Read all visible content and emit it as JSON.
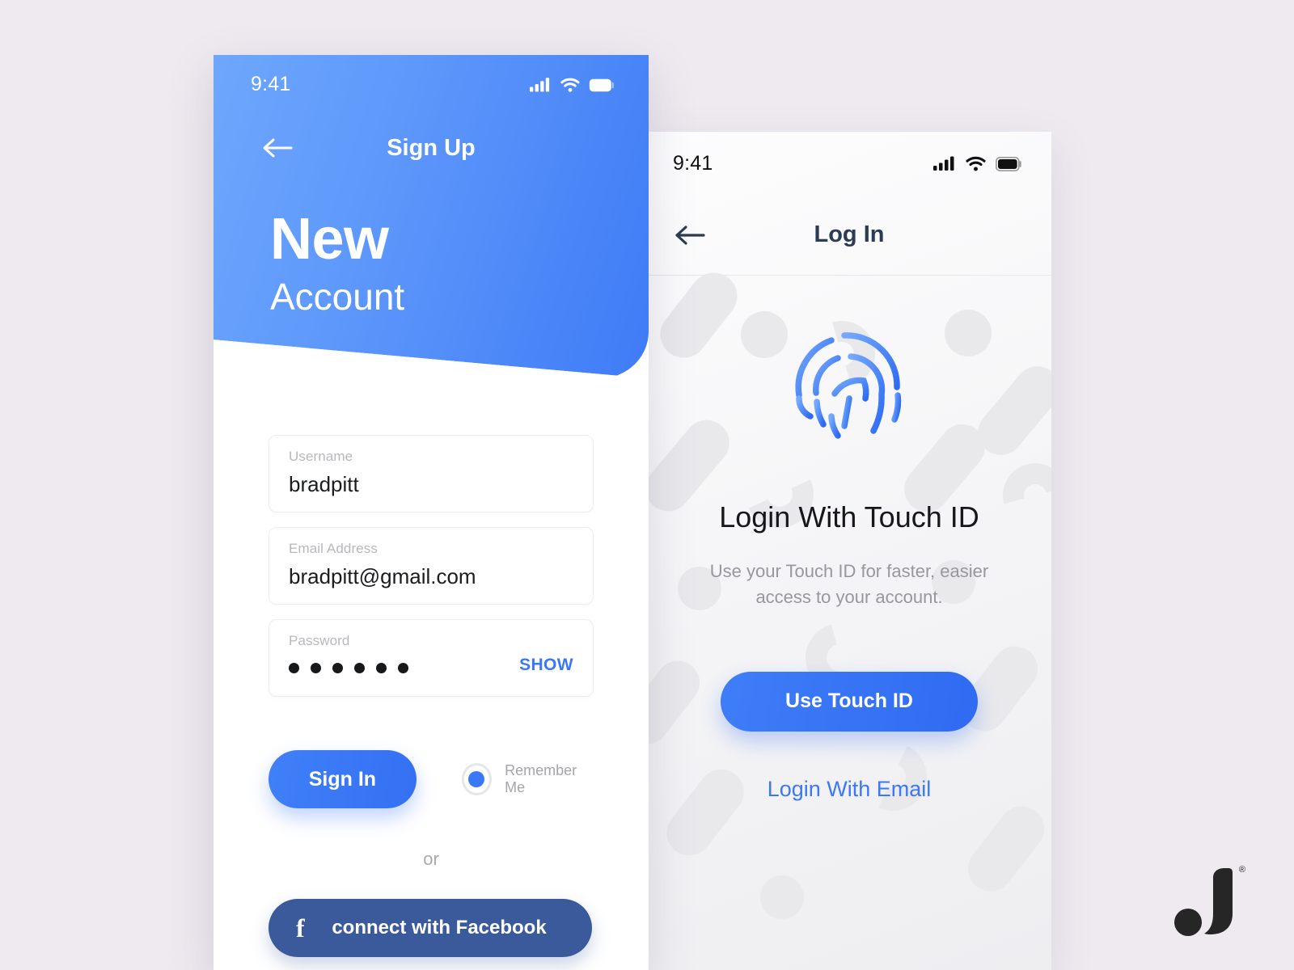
{
  "page": {
    "background_color": "#eeeaf0",
    "accent_blue": "#3b78f7",
    "facebook_blue": "#3b5a9b"
  },
  "signup_screen": {
    "status_bar": {
      "time": "9:41",
      "signal_icon": "cellular-signal-icon",
      "wifi_icon": "wifi-icon",
      "battery_icon": "battery-icon"
    },
    "nav": {
      "back_icon": "back-arrow-icon",
      "title": "Sign Up"
    },
    "hero": {
      "line1": "New",
      "line2": "Account"
    },
    "fields": [
      {
        "label": "Username",
        "value": "bradpitt"
      },
      {
        "label": "Email Address",
        "value": "bradpitt@gmail.com"
      }
    ],
    "password_field": {
      "label": "Password",
      "masked_dots": 6,
      "show_label": "SHOW"
    },
    "signin_button": "Sign In",
    "remember_me": {
      "label": "Remember Me",
      "checked": true
    },
    "divider_text": "or",
    "facebook_button": {
      "icon": "facebook-f-icon",
      "label": "connect with Facebook"
    }
  },
  "login_screen": {
    "status_bar": {
      "time": "9:41",
      "signal_icon": "cellular-signal-icon",
      "wifi_icon": "wifi-icon",
      "battery_icon": "battery-icon"
    },
    "nav": {
      "back_icon": "back-arrow-icon",
      "title": "Log In"
    },
    "fingerprint_icon": "fingerprint-icon",
    "heading": "Login With Touch ID",
    "description": "Use your Touch ID for faster, easier access to your account.",
    "primary_button": "Use Touch ID",
    "secondary_link": "Login With Email"
  },
  "branding": {
    "logo_icon": "j-letter-logo",
    "registered_mark": "®"
  }
}
